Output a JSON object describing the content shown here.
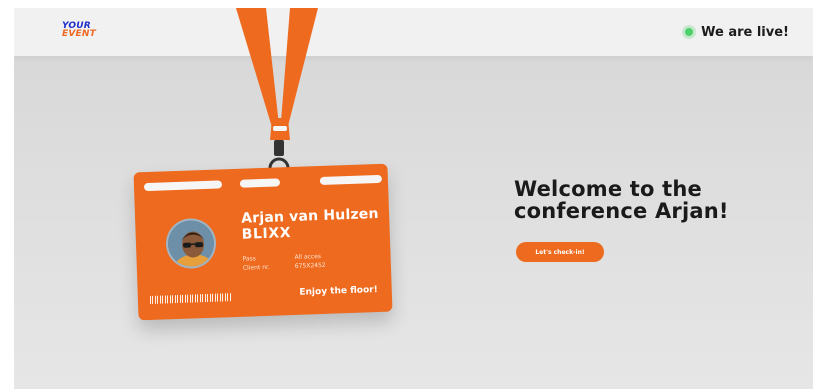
{
  "header": {
    "logo_line1": "YOUR",
    "logo_line2": "EVENT",
    "live_text": "We are live!"
  },
  "badge": {
    "name": "Arjan van Hulzen",
    "company": "BLIXX",
    "pass_label": "Pass",
    "pass_value": "All acces",
    "client_label": "Client nr.",
    "client_value": "675X2452",
    "footer_text": "Enjoy the floor!"
  },
  "main": {
    "welcome_line1": "Welcome to the",
    "welcome_line2": "conference Arjan!",
    "cta_label": "Let's check-in!"
  },
  "colors": {
    "accent": "#ee6a1f",
    "logo_blue": "#1e2fc8",
    "live_green": "#4cd16a",
    "background": "#dcdcdc"
  },
  "icons": [
    "live-status-dot",
    "lanyard-clip",
    "avatar-photo",
    "barcode"
  ]
}
